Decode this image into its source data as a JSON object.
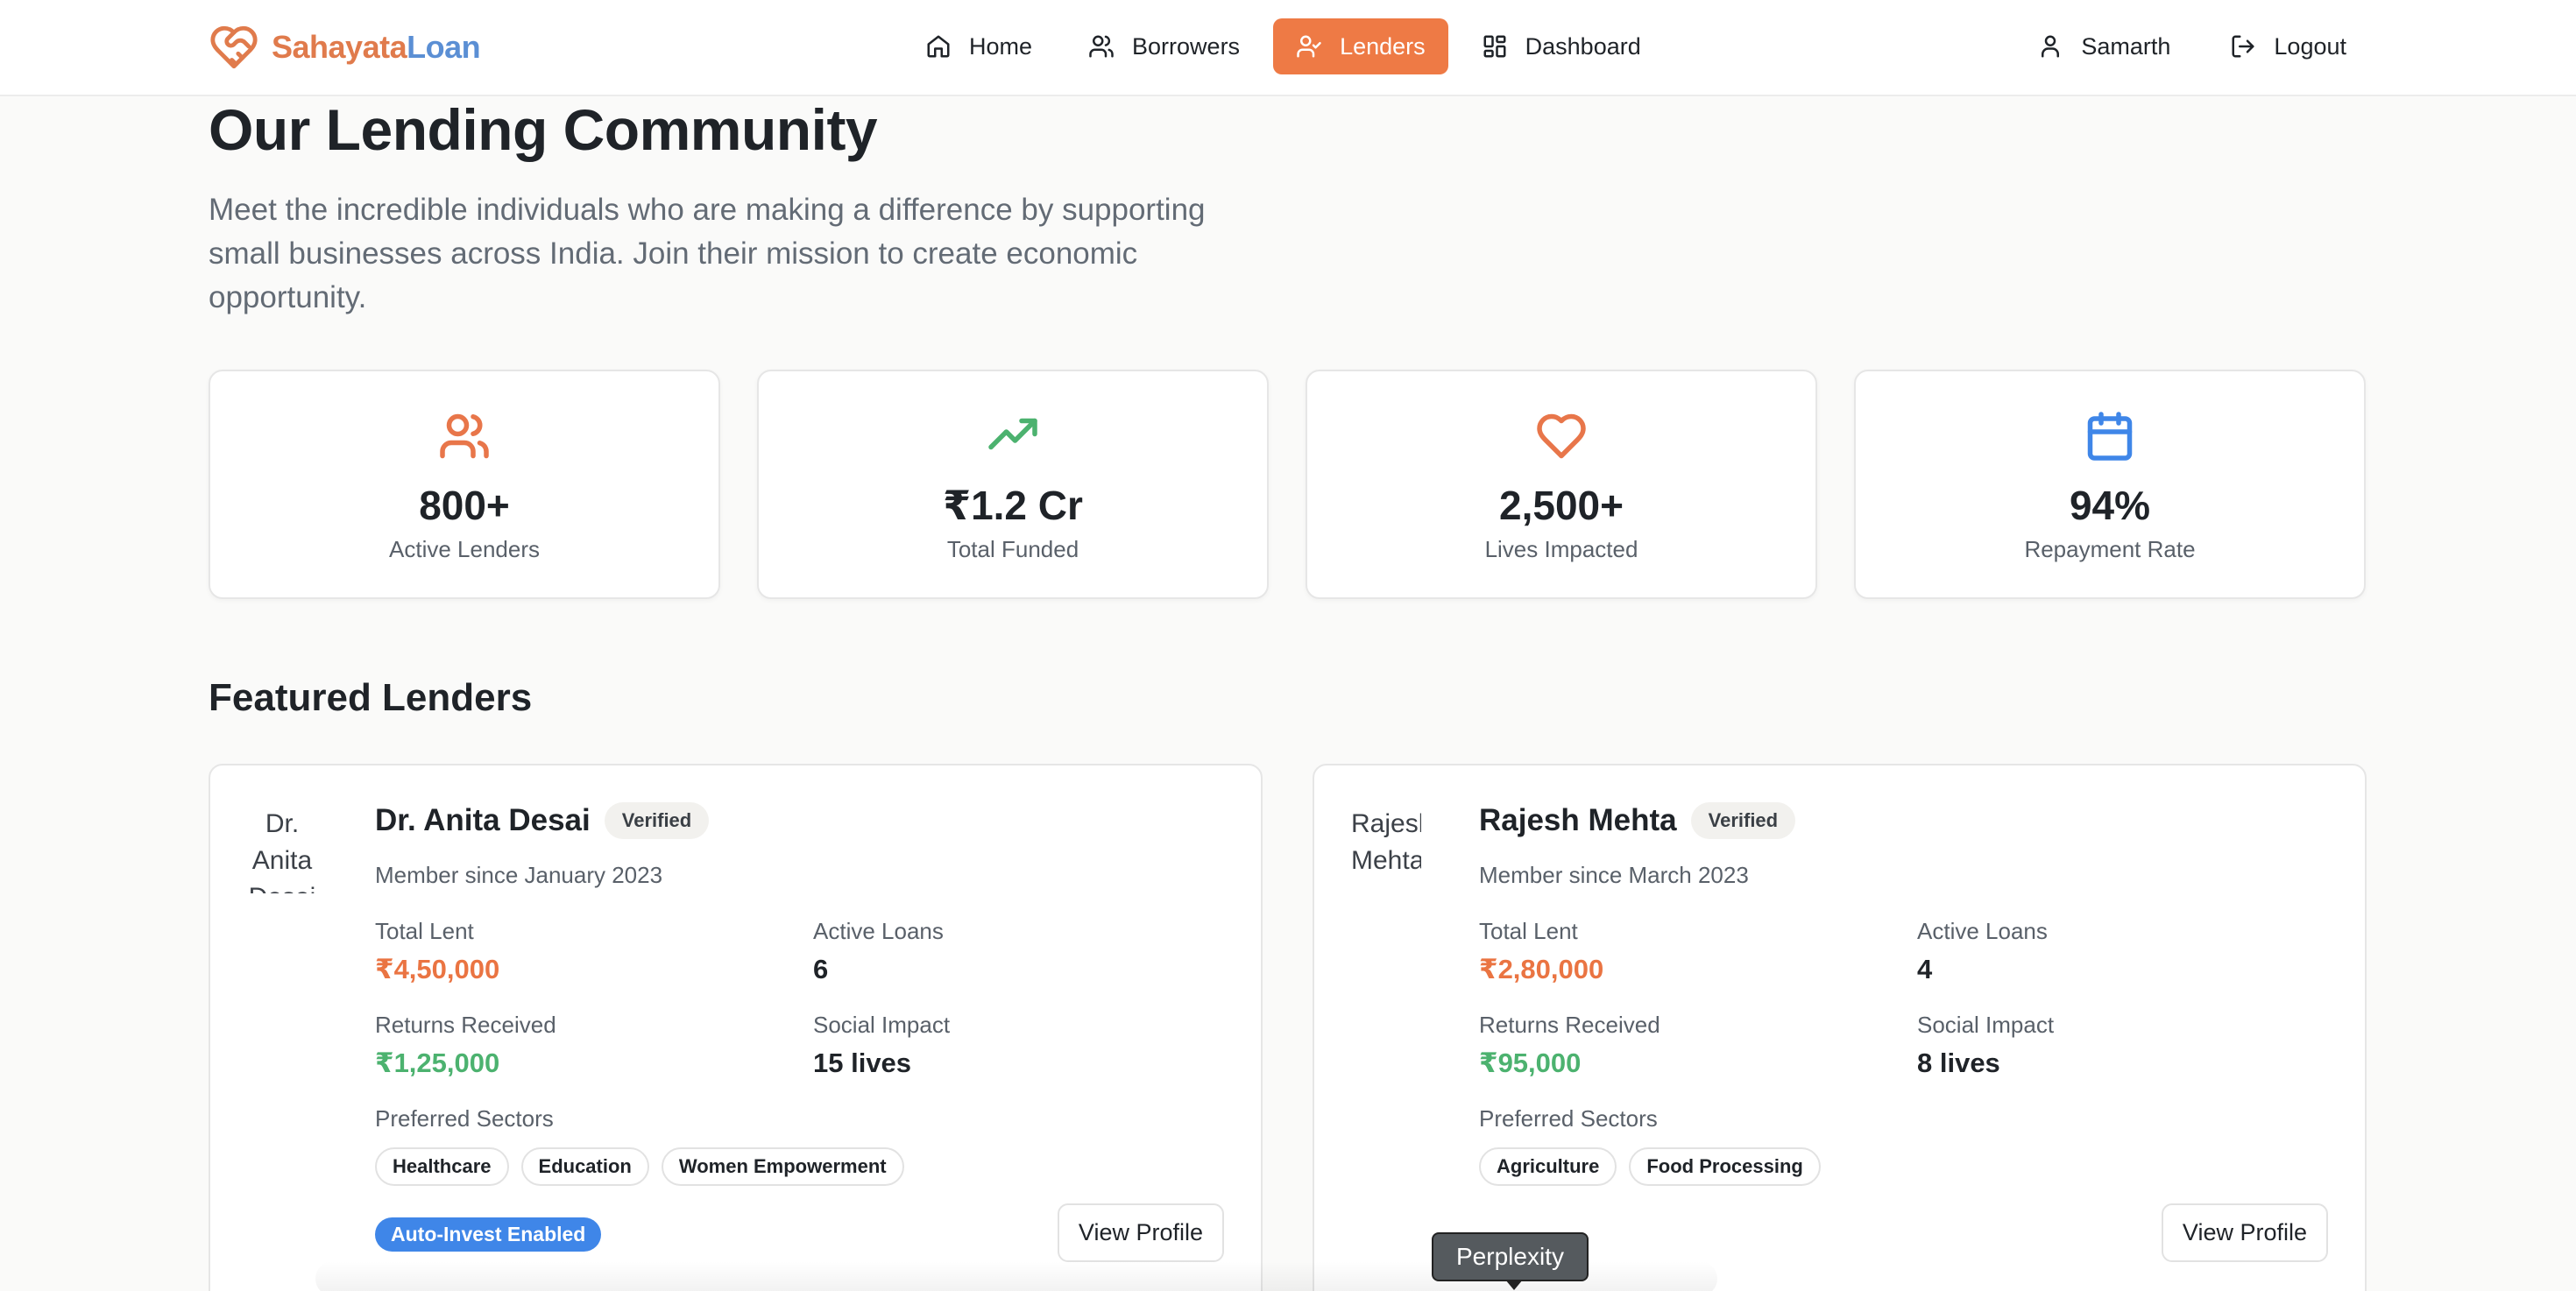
{
  "brand": {
    "part1": "Sahayata",
    "part2": "Loan",
    "colors": {
      "primary": "#e07b4c",
      "secondary": "#5b8fd4"
    }
  },
  "nav": {
    "links": [
      {
        "label": "Home",
        "icon": "home-icon"
      },
      {
        "label": "Borrowers",
        "icon": "users-icon"
      },
      {
        "label": "Lenders",
        "icon": "user-check-icon",
        "active": true
      },
      {
        "label": "Dashboard",
        "icon": "dashboard-icon"
      }
    ],
    "user": {
      "label": "Samarth",
      "icon": "user-icon"
    },
    "logout": {
      "label": "Logout",
      "icon": "logout-icon"
    },
    "accent": "#ee7a45"
  },
  "hero": {
    "title": "Our Lending Community",
    "intro": "Meet the incredible individuals who are making a difference by supporting small businesses across India. Join their mission to create economic opportunity."
  },
  "stats": [
    {
      "value": "800+",
      "label": "Active Lenders",
      "icon": "users-icon",
      "color": "#e8764a"
    },
    {
      "value": "₹1.2 Cr",
      "label": "Total Funded",
      "icon": "trending-up-icon",
      "color": "#4cb26f"
    },
    {
      "value": "2,500+",
      "label": "Lives Impacted",
      "icon": "heart-icon",
      "color": "#e8764a"
    },
    {
      "value": "94%",
      "label": "Repayment Rate",
      "icon": "calendar-icon",
      "color": "#3f86e8"
    }
  ],
  "featured": {
    "title": "Featured Lenders",
    "lenders": [
      {
        "avatar_alt": "Dr. Anita Desai",
        "name": "Dr. Anita Desai",
        "badge": "Verified",
        "member_since": "Member since January 2023",
        "total_lent_label": "Total Lent",
        "total_lent": "₹4,50,000",
        "active_loans_label": "Active Loans",
        "active_loans": "6",
        "returns_label": "Returns Received",
        "returns": "₹1,25,000",
        "impact_label": "Social Impact",
        "impact": "15 lives",
        "sectors_label": "Preferred Sectors",
        "sectors": [
          "Healthcare",
          "Education",
          "Women Empowerment"
        ],
        "auto_invest": "Auto-Invest Enabled",
        "view_profile": "View Profile"
      },
      {
        "avatar_alt": "Rajesh Mehta",
        "name": "Rajesh Mehta",
        "badge": "Verified",
        "member_since": "Member since March 2023",
        "total_lent_label": "Total Lent",
        "total_lent": "₹2,80,000",
        "active_loans_label": "Active Loans",
        "active_loans": "4",
        "returns_label": "Returns Received",
        "returns": "₹95,000",
        "impact_label": "Social Impact",
        "impact": "8 lives",
        "sectors_label": "Preferred Sectors",
        "sectors": [
          "Agriculture",
          "Food Processing"
        ],
        "view_profile": "View Profile"
      }
    ]
  },
  "tooltip": {
    "text": "Perplexity"
  }
}
